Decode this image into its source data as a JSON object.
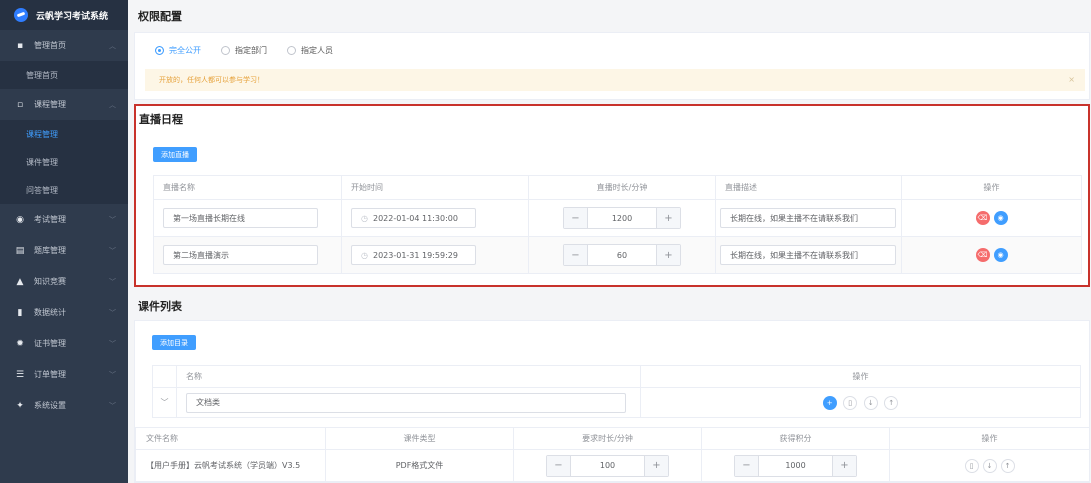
{
  "app": {
    "title": "云帆学习考试系统"
  },
  "sidebar": {
    "items": [
      {
        "icon": "grid-icon",
        "glyph": "▪",
        "label": "管理首页",
        "arrow": "︿",
        "sub": [
          {
            "label": "管理首页"
          }
        ]
      },
      {
        "icon": "monitor-icon",
        "glyph": "▫",
        "label": "课程管理",
        "arrow": "︿",
        "sub": [
          {
            "label": "课程管理",
            "active": true
          },
          {
            "label": "课件管理"
          },
          {
            "label": "问答管理"
          }
        ]
      },
      {
        "icon": "exam-icon",
        "glyph": "◉",
        "label": "考试管理",
        "arrow": "﹀"
      },
      {
        "icon": "bank-icon",
        "glyph": "▤",
        "label": "题库管理",
        "arrow": "﹀"
      },
      {
        "icon": "contest-icon",
        "glyph": "▲",
        "label": "知识竞赛",
        "arrow": "﹀"
      },
      {
        "icon": "chart-icon",
        "glyph": "▮",
        "label": "数据统计",
        "arrow": "﹀"
      },
      {
        "icon": "certificate-icon",
        "glyph": "✹",
        "label": "证书管理",
        "arrow": "﹀"
      },
      {
        "icon": "order-icon",
        "glyph": "☰",
        "label": "订单管理",
        "arrow": "﹀"
      },
      {
        "icon": "settings-icon",
        "glyph": "✦",
        "label": "系统设置",
        "arrow": "﹀"
      }
    ]
  },
  "permission": {
    "title": "权限配置",
    "options": [
      "完全公开",
      "指定部门",
      "指定人员"
    ],
    "selected": "完全公开",
    "notice": "开放的，任何人都可以参与学习！",
    "close": "×"
  },
  "live": {
    "title": "直播日程",
    "add_button": "添加直播",
    "columns": [
      "直播名称",
      "开始时间",
      "直播时长/分钟",
      "直播描述",
      "操作"
    ],
    "rows": [
      {
        "name": "第一场直播长期在线",
        "start": "2022-01-04 11:30:00",
        "duration": "1200",
        "desc": "长期在线，如果主播不在请联系我们"
      },
      {
        "name": "第二场直播演示",
        "start": "2023-01-31 19:59:29",
        "duration": "60",
        "desc": "长期在线，如果主播不在请联系我们"
      }
    ]
  },
  "courseware": {
    "title": "课件列表",
    "add_button": "添加目录",
    "dir_columns": [
      "名称",
      "操作"
    ],
    "dir_row": {
      "expand": "﹀",
      "name": "文档类"
    },
    "file_columns": [
      "文件名称",
      "课件类型",
      "要求时长/分钟",
      "获得积分",
      "操作"
    ],
    "file_rows": [
      {
        "name": "【用户手册】云帆考试系统（学员端）V3.5",
        "type": "PDF格式文件",
        "duration": "100",
        "points": "1000"
      }
    ]
  },
  "symbols": {
    "minus": "−",
    "plus": "+",
    "clock": "◷",
    "delete": "⌫",
    "view": "◉",
    "add": "+",
    "trash": "▯",
    "down": "↓",
    "up": "↑"
  },
  "colors": {
    "primary": "#409eff",
    "danger": "#f56c6c",
    "highlight_border": "#c8322b",
    "sidebar": "#2f3b4d"
  }
}
